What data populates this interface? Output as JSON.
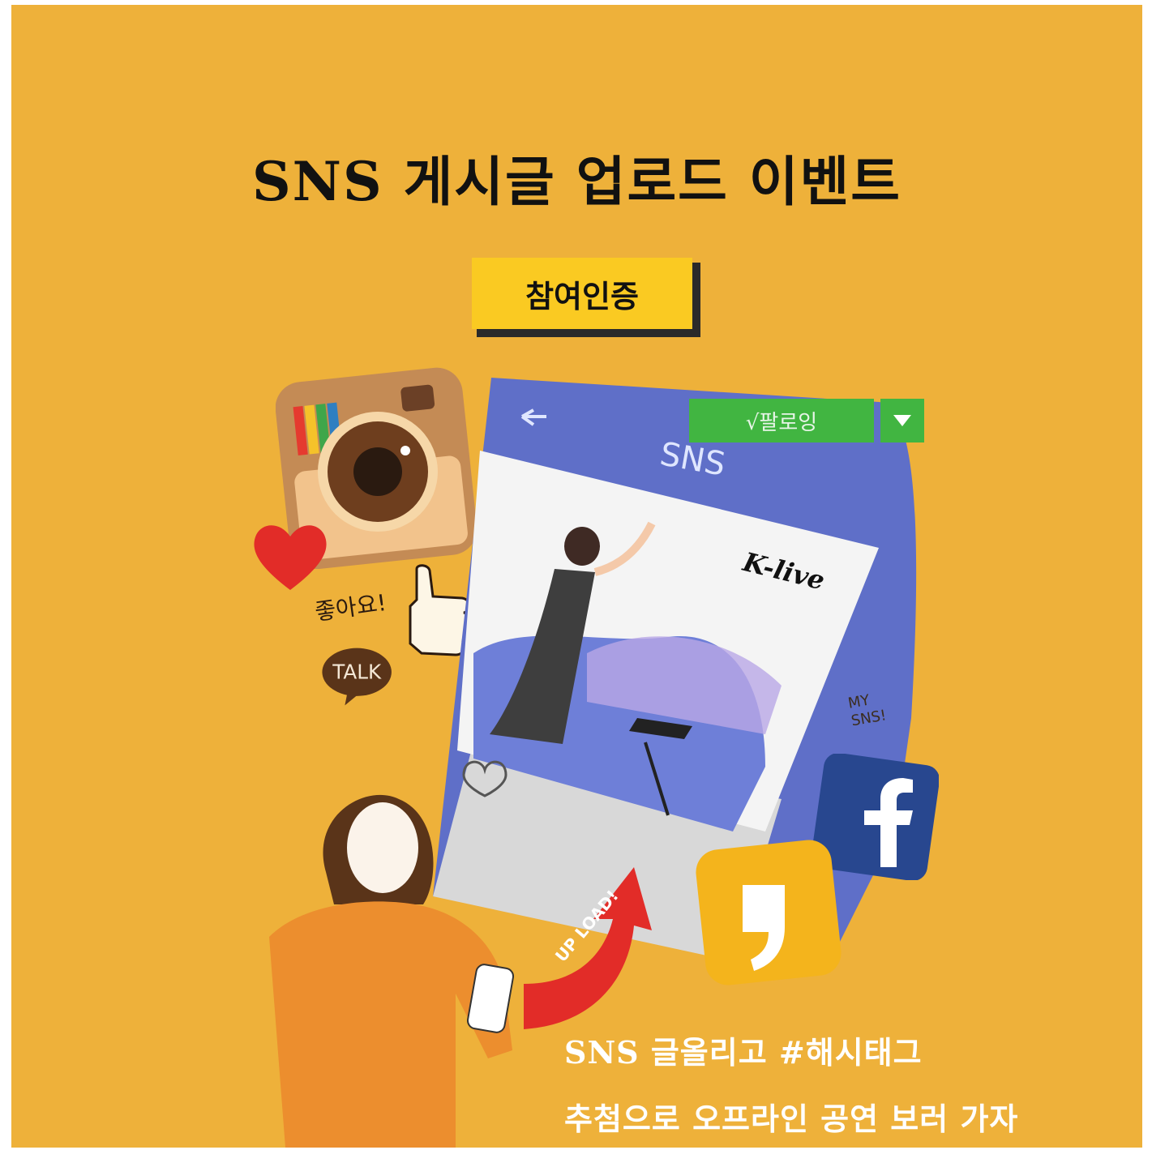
{
  "title": "SNS 게시글 업로드 이벤트",
  "badge_label": "참여인증",
  "phone": {
    "header_label": "SNS",
    "follow_label": "√팔로잉",
    "brand_text": "K-live",
    "more_label": "..."
  },
  "stickers": {
    "like_text": "좋아요!",
    "talk_text": "TALK",
    "my_sns_line1": "MY",
    "my_sns_line2": "SNS!",
    "upload_text": "UP LOAD!"
  },
  "captions": {
    "line1": "SNS 글올리고 #해시태그",
    "line2": "추첨으로 오프라인 공연 보러 가자"
  },
  "colors": {
    "background": "#EEB13A",
    "badge": "#FACA22",
    "follow_green": "#41B541",
    "phone_blue": "#5F6FC8"
  }
}
